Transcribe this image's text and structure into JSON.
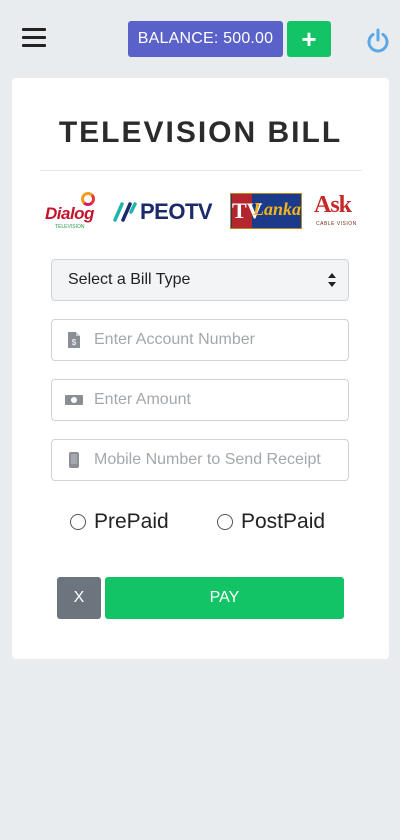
{
  "header": {
    "balance_label": "BALANCE: 500.00",
    "add_label": "+"
  },
  "card": {
    "title": "TELEVISION BILL",
    "logos": [
      {
        "name": "Dialog",
        "sub": "TELEVISION"
      },
      {
        "name": "PEOTV"
      },
      {
        "name": "TV Lanka",
        "tv": "TV",
        "lanka": "Lanka"
      },
      {
        "name": "Ask",
        "sub": "CABLE VISION"
      }
    ],
    "select": {
      "value": "Select a Bill Type"
    },
    "fields": {
      "account": {
        "placeholder": "Enter Account Number"
      },
      "amount": {
        "placeholder": "Enter Amount"
      },
      "mobile": {
        "placeholder": "Mobile Number to Send Receipt"
      }
    },
    "radios": {
      "prepaid": "PrePaid",
      "postpaid": "PostPaid"
    },
    "buttons": {
      "cancel": "X",
      "pay": "PAY"
    }
  },
  "colors": {
    "balance_bg": "#5a62c9",
    "accent_green": "#13c467",
    "power_icon": "#5aa8e6",
    "cancel_bg": "#6c757d"
  },
  "icons": [
    "menu-icon",
    "power-icon",
    "document-icon",
    "money-icon",
    "mobile-icon",
    "sort-arrows-icon"
  ]
}
